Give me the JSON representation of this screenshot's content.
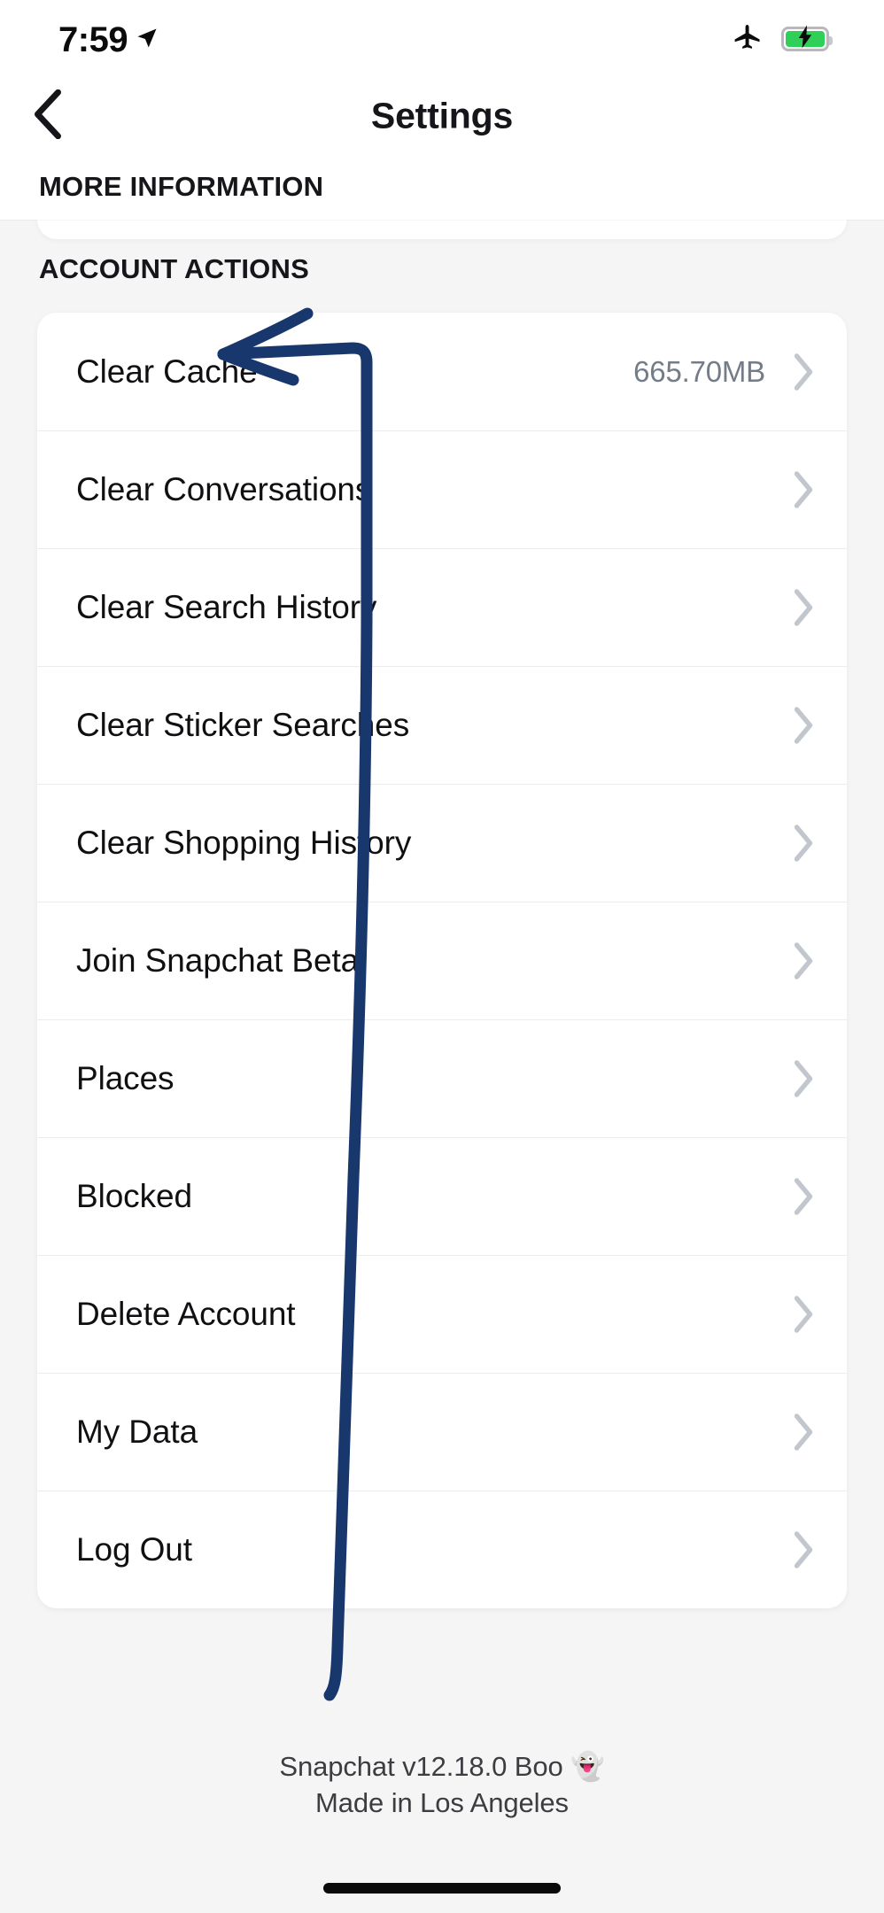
{
  "status_bar": {
    "time": "7:59",
    "location_icon": "location-arrow-icon",
    "airplane_icon": "airplane-mode-icon",
    "battery_icon": "battery-charging-icon"
  },
  "nav": {
    "back_icon": "chevron-left-icon",
    "title": "Settings"
  },
  "sticky_section": {
    "label": "MORE INFORMATION"
  },
  "section": {
    "label": "ACCOUNT ACTIONS"
  },
  "rows": [
    {
      "label": "Clear Cache",
      "value": "665.70MB",
      "chevron": "chevron-right-icon"
    },
    {
      "label": "Clear Conversations",
      "value": "",
      "chevron": "chevron-right-icon"
    },
    {
      "label": "Clear Search History",
      "value": "",
      "chevron": "chevron-right-icon"
    },
    {
      "label": "Clear Sticker Searches",
      "value": "",
      "chevron": "chevron-right-icon"
    },
    {
      "label": "Clear Shopping History",
      "value": "",
      "chevron": "chevron-right-icon"
    },
    {
      "label": "Join Snapchat Beta",
      "value": "",
      "chevron": "chevron-right-icon"
    },
    {
      "label": "Places",
      "value": "",
      "chevron": "chevron-right-icon"
    },
    {
      "label": "Blocked",
      "value": "",
      "chevron": "chevron-right-icon"
    },
    {
      "label": "Delete Account",
      "value": "",
      "chevron": "chevron-right-icon"
    },
    {
      "label": "My Data",
      "value": "",
      "chevron": "chevron-right-icon"
    },
    {
      "label": "Log Out",
      "value": "",
      "chevron": "chevron-right-icon"
    }
  ],
  "footer": {
    "version_line": "Snapchat v12.18.0 Boo 👻",
    "made_line": "Made in Los Angeles"
  },
  "annotation": {
    "type": "hand-drawn-arrow",
    "target_row_label": "Clear Cache",
    "color": "#17376d"
  },
  "colors": {
    "page_background": "#f5f5f6",
    "card_background": "#ffffff",
    "primary_text": "#101013",
    "secondary_text": "#737c87",
    "chevron": "#c2c7ce",
    "separator": "#ececef",
    "battery_green": "#2fd058",
    "annotation_navy": "#17376d"
  }
}
